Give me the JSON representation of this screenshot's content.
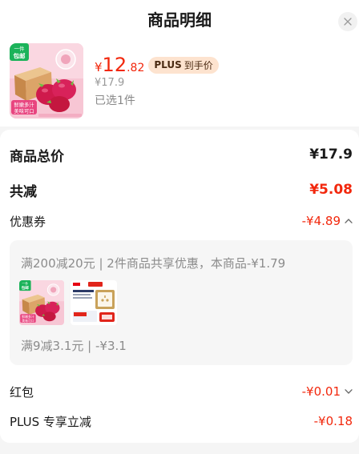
{
  "header": {
    "title": "商品明细",
    "close_icon": "close-icon"
  },
  "product": {
    "image": {
      "badge_top_line1": "一件",
      "badge_top_line2": "包邮",
      "badge_bottom_line1": "鲜嫩多汁",
      "badge_bottom_line2": "美味可口"
    },
    "price": {
      "currency": "¥",
      "integer": "12",
      "decimal": ".82"
    },
    "plus_badge": {
      "brand": "PLUS",
      "label": "到手价"
    },
    "original_price": "¥17.9",
    "selected_count": "已选1件"
  },
  "summary": {
    "total": {
      "label": "商品总价",
      "value": "¥17.9"
    },
    "discount": {
      "label": "共减",
      "value": "¥5.08"
    },
    "coupon": {
      "label": "优惠券",
      "value": "-¥4.89",
      "icon": "chevron-up-icon",
      "expanded": true,
      "details": [
        {
          "text": "满200减20元 | 2件商品共享优惠，本商品-¥1.79"
        },
        {
          "text": "满9减3.1元 | -¥3.1"
        }
      ]
    },
    "red_packet": {
      "label": "红包",
      "value": "-¥0.01",
      "icon": "chevron-down-icon",
      "expanded": false
    },
    "plus_discount": {
      "label": "PLUS 专享立减",
      "value": "-¥0.18"
    }
  },
  "colors": {
    "accent": "#f2270c",
    "text_primary": "#1a1a1a",
    "text_secondary": "#999999",
    "plus_badge_bg": "#fde3cf",
    "page_bg": "#f5f5f5"
  }
}
